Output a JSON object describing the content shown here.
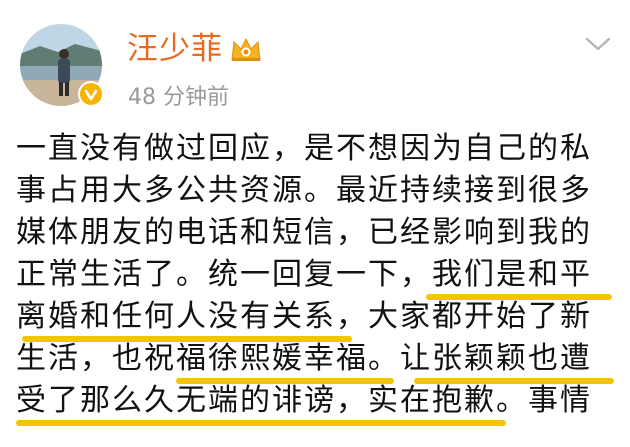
{
  "post": {
    "username": "汪少菲",
    "timestamp": "48 分钟前",
    "text_lines": [
      "一直没有做过回应，是不想因为自己的私",
      "事占用大多公共资源。最近持续接到很多",
      "媒体朋友的电话和短信，已经影响到我的",
      "正常生活了。统一回复一下，我们是和平",
      "离婚和任何人没有关系，大家都开始了新",
      "生活，也祝福徐熙媛幸福。让张颖颖也遭",
      "受了那么久无端的诽谤，实在抱歉。事情"
    ]
  },
  "colors": {
    "username": "#e86a1e",
    "highlight": "#f5c400",
    "verified": "#f7b500",
    "timestamp": "#9a9a9a"
  },
  "icons": {
    "verified": "verified-badge-icon",
    "member": "crown-member-icon",
    "menu": "chevron-down-icon"
  }
}
